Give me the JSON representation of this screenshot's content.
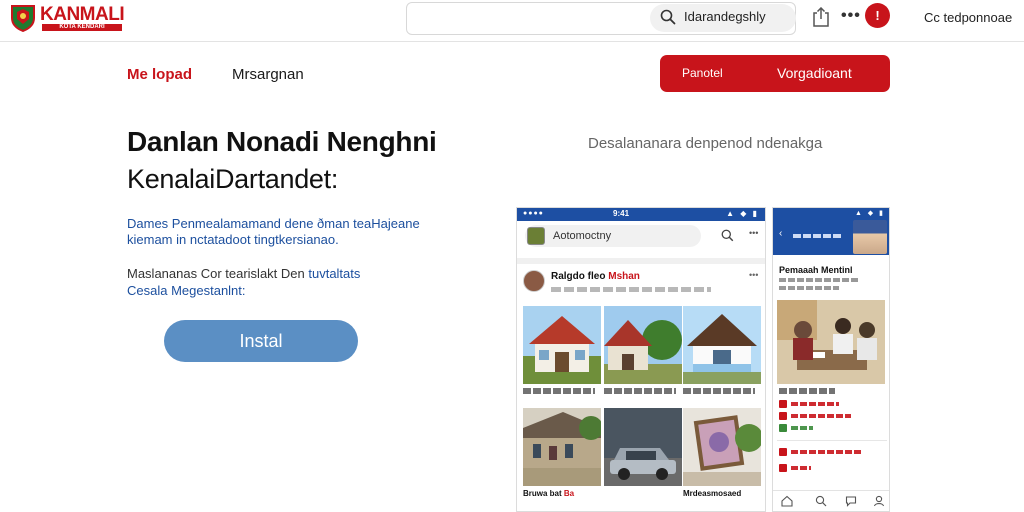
{
  "topbar": {
    "logo_text": "KANMALI",
    "logo_subtext": "KOTA KENDARI",
    "search_text": "Idarandegshly",
    "notification_count": "!",
    "account_label": "Cc tedponnoae"
  },
  "nav": {
    "home_label": "Me lopad",
    "menu_label": "Mrsargnan",
    "cta_left_label": "Panotel",
    "cta_right_label": "Vorgadioant"
  },
  "hero": {
    "title_line1": "Danlan Nonadi Nenghni",
    "title_line2": "KenalaiDartandet:",
    "desc_line1": "Dames Penmealamamand dene ðman teaHajeane",
    "desc_line2": "kiemam in nctatadoot tingtkersianao.",
    "note_line1_prefix": "Maslananas Cor tearislakt Den ",
    "note_line1_link": "tuvtaltats",
    "note_line2": "Cesala Megestanlnt:",
    "install_label": "Instal"
  },
  "right_caption": "Desalananara denpenod ndenakga",
  "phone1": {
    "status_time": "9:41",
    "search_text": "Aotomoctny",
    "post_author_prefix": "Ralgdo fleo ",
    "post_author_red": "Mshan",
    "bottom_caption_left": "Bruwa bat",
    "bottom_caption_red": "Ba",
    "bottom_caption_right": "Mrdeasmosaed"
  },
  "phone2": {
    "title": "Pemaaah Mentinl"
  },
  "colors": {
    "brand_red": "#c8141b",
    "header_blue": "#1d4fa3",
    "link_blue": "#1c4f9e",
    "install_blue": "#5b8fc4"
  },
  "icons": {
    "logo": "shield-logo-icon",
    "search": "search-icon",
    "share": "share-icon",
    "more": "more-icon",
    "home": "home-icon",
    "search_nav": "search-icon",
    "chat": "chat-icon",
    "profile": "profile-icon"
  }
}
